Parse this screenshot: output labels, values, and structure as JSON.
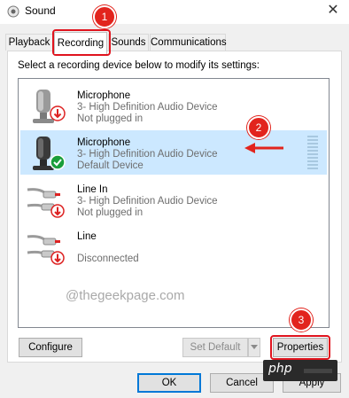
{
  "window": {
    "title": "Sound",
    "close_glyph": "✕",
    "app_icon": "speaker-icon"
  },
  "tabs": [
    {
      "label": "Playback"
    },
    {
      "label": "Recording",
      "active": true
    },
    {
      "label": "Sounds"
    },
    {
      "label": "Communications"
    }
  ],
  "instruction": "Select a recording device below to modify its settings:",
  "devices": [
    {
      "name": "Microphone",
      "driver": "3- High Definition Audio Device",
      "status": "Not plugged in",
      "icon": "microphone-icon",
      "status_icon": "down-arrow-badge",
      "selected": false
    },
    {
      "name": "Microphone",
      "driver": "3- High Definition Audio Device",
      "status": "Default Device",
      "icon": "microphone-icon",
      "status_icon": "check-badge",
      "selected": true
    },
    {
      "name": "Line In",
      "driver": "3- High Definition Audio Device",
      "status": "Not plugged in",
      "icon": "line-in-cable-icon",
      "status_icon": "down-arrow-badge",
      "selected": false
    },
    {
      "name": "Line",
      "driver": "",
      "status": "Disconnected",
      "icon": "line-cable-icon",
      "status_icon": "down-arrow-badge",
      "selected": false
    }
  ],
  "watermark": "@thegeekpage.com",
  "buttons": {
    "configure": "Configure",
    "set_default": "Set Default",
    "properties": "Properties",
    "ok": "OK",
    "cancel": "Cancel",
    "apply": "Apply"
  },
  "annotations": {
    "step1": "1",
    "step2": "2",
    "step3": "3",
    "color": "#e2241d"
  },
  "branding": {
    "php_label": "php"
  },
  "colors": {
    "selected_row": "#cce8ff",
    "status_red": "#e0141e",
    "status_green": "#1a9e3a"
  }
}
